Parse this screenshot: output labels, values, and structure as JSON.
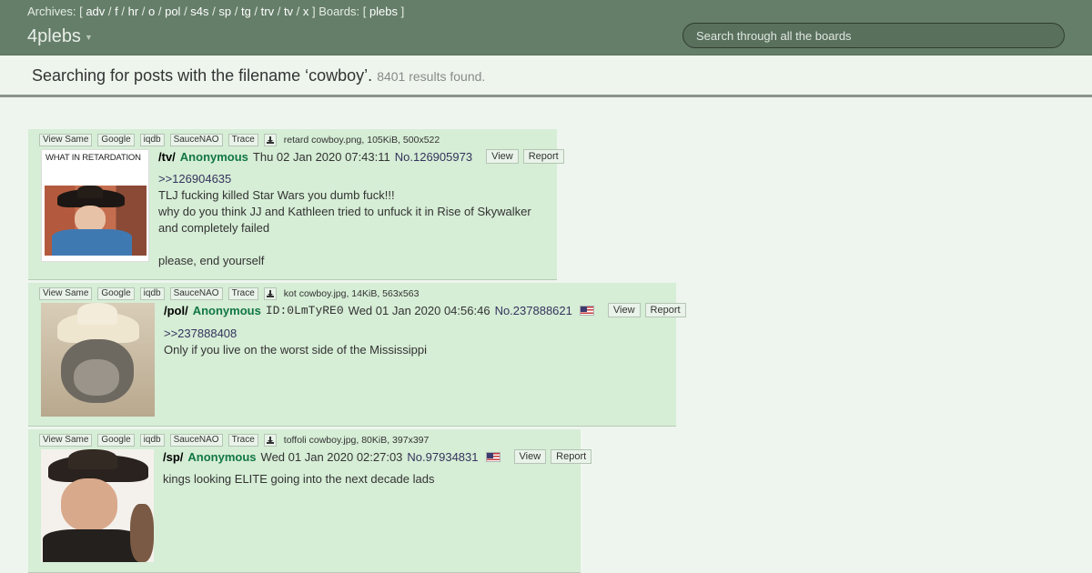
{
  "header": {
    "archives_label": "Archives:",
    "boards_label": "Boards:",
    "archives": [
      "adv",
      "f",
      "hr",
      "o",
      "pol",
      "s4s",
      "sp",
      "tg",
      "trv",
      "tv",
      "x"
    ],
    "boards": [
      "plebs"
    ],
    "brand": "4plebs",
    "search_placeholder": "Search through all the boards"
  },
  "heading": {
    "text": "Searching for posts with the filename ‘cowboy’.",
    "count": "8401 results found."
  },
  "file_actions": [
    "View Same",
    "Google",
    "iqdb",
    "SauceNAO",
    "Trace"
  ],
  "post_actions": {
    "view": "View",
    "report": "Report"
  },
  "posts": [
    {
      "file_info": "retard cowboy.png, 105KiB, 500x522",
      "thumb_caption": "WHAT IN RETARDATION",
      "board": "/tv/",
      "name": "Anonymous",
      "date": "Thu 02 Jan 2020 07:43:11",
      "number": "No.126905973",
      "lines": [
        "TLJ fucking killed Star Wars you dumb fuck!!!",
        "why do you think JJ and Kathleen tried to unfuck it in Rise of Skywalker",
        "and completely failed",
        "",
        "please, end yourself"
      ],
      "quote": ">>126904635"
    },
    {
      "file_info": "kot cowboy.jpg, 14KiB, 563x563",
      "board": "/pol/",
      "name": "Anonymous",
      "poster_id": "ID:0LmTyRE0",
      "date": "Wed 01 Jan 2020 04:56:46",
      "number": "No.237888621",
      "quote": ">>237888408",
      "lines": [
        "Only if you live on the worst side of the Mississippi"
      ]
    },
    {
      "file_info": "toffoli cowboy.jpg, 80KiB, 397x397",
      "board": "/sp/",
      "name": "Anonymous",
      "date": "Wed 01 Jan 2020 02:27:03",
      "number": "No.97934831",
      "lines": [
        "kings looking ELITE going into the next decade lads"
      ]
    }
  ],
  "colors": {
    "topbar": "#657e69",
    "post_bg": "#d6edd6",
    "name_green": "#117743",
    "link_blue": "#34345c",
    "page_bg": "#eef5ee"
  },
  "icons": {
    "download": "download-icon",
    "flag": "us-flag-icon",
    "caret": "caret-down-icon"
  }
}
